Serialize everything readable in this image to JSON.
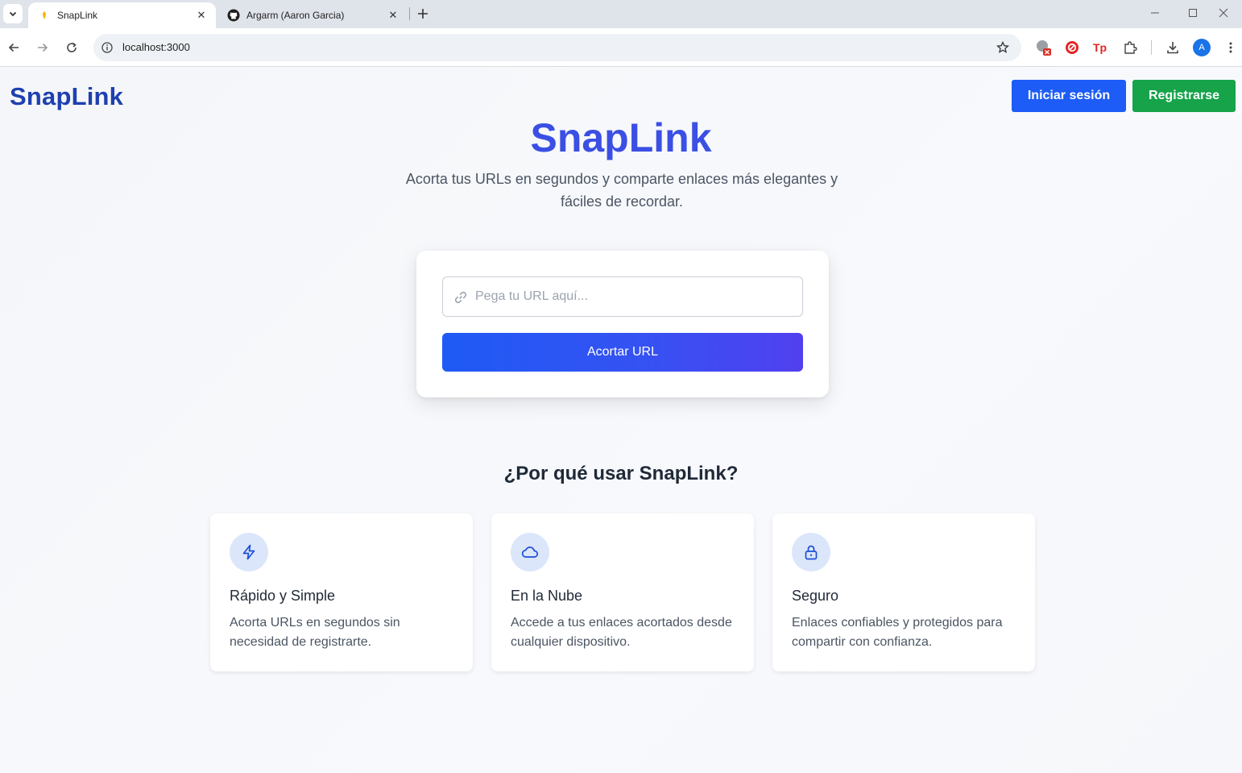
{
  "browser": {
    "tabs": [
      {
        "title": "SnapLink",
        "active": true
      },
      {
        "title": "Argarm (Aaron Garcia)",
        "active": false
      }
    ],
    "address": "localhost:3000",
    "profile_initial": "A"
  },
  "header": {
    "brand": "SnapLink",
    "login_label": "Iniciar sesión",
    "register_label": "Registrarse"
  },
  "hero": {
    "title": "SnapLink",
    "subtitle": "Acorta tus URLs en segundos y comparte enlaces más elegantes y fáciles de recordar."
  },
  "shortener": {
    "input_placeholder": "Pega tu URL aquí...",
    "input_value": "",
    "button_label": "Acortar URL"
  },
  "features": {
    "heading": "¿Por qué usar SnapLink?",
    "items": [
      {
        "icon": "lightning-icon",
        "title": "Rápido y Simple",
        "description": "Acorta URLs en segundos sin necesidad de registrarte."
      },
      {
        "icon": "cloud-icon",
        "title": "En la Nube",
        "description": "Accede a tus enlaces acortados desde cualquier dispositivo."
      },
      {
        "icon": "lock-icon",
        "title": "Seguro",
        "description": "Enlaces confiables y protegidos para compartir con confianza."
      }
    ]
  },
  "colors": {
    "primary": "#1d5cf6",
    "success": "#16a34a",
    "brand": "#1e40af",
    "hero_title": "#3b4fe4"
  }
}
